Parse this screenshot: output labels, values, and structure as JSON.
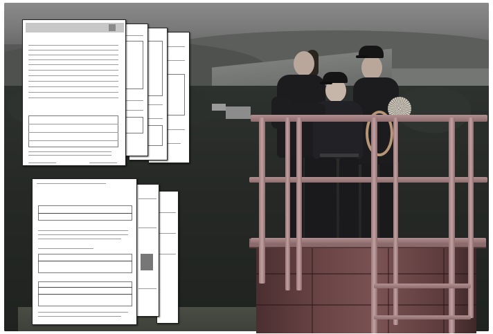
{
  "scene": {
    "subject": "",
    "colors": {
      "sky": "#7a7a7a",
      "forest": "#2b2e2b",
      "chimney": "#6b4546",
      "railing": "#b08f90",
      "document_paper": "#ffffff"
    }
  },
  "document_stack_top": {
    "front": {
      "header_line_1": "",
      "header_line_2": "",
      "subheader": "",
      "section_1": "",
      "section_2": ""
    }
  },
  "document_stack_bottom": {
    "front": {
      "title": "",
      "subtitle": "",
      "tag": "",
      "section_1": "",
      "section_2": "",
      "section_3": ""
    }
  }
}
